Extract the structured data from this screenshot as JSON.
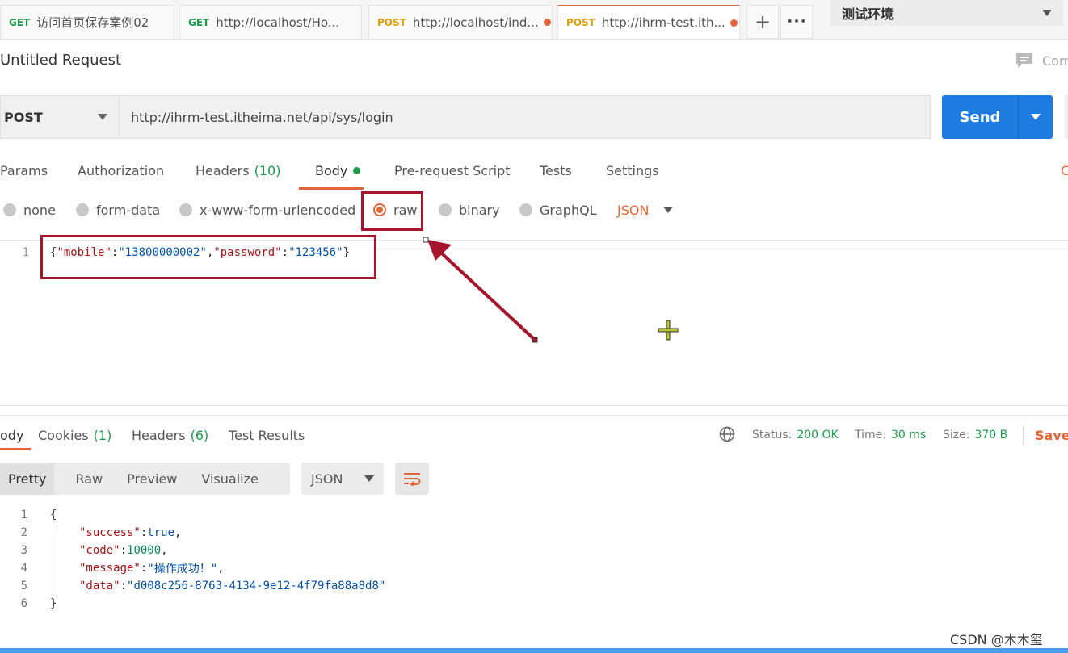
{
  "tabs": [
    {
      "method": "GET",
      "title": "访问首页保存案例02",
      "modified": false,
      "active": false
    },
    {
      "method": "GET",
      "title": "http://localhost/Ho...",
      "modified": false,
      "active": false
    },
    {
      "method": "POST",
      "title": "http://localhost/ind...",
      "modified": true,
      "active": false
    },
    {
      "method": "POST",
      "title": "http://ihrm-test.ith...",
      "modified": true,
      "active": true
    }
  ],
  "tab_actions": {
    "add": "+",
    "more": "•••"
  },
  "environment": {
    "selected": "测试环境"
  },
  "request": {
    "title": "Untitled Request",
    "comments_label": "Com",
    "method": "POST",
    "url": "http://ihrm-test.itheima.net/api/sys/login",
    "send_label": "Send",
    "sub_tabs": {
      "params": "Params",
      "authorization": "Authorization",
      "headers": "Headers",
      "headers_count": "(10)",
      "body": "Body",
      "prerequest": "Pre-request Script",
      "tests": "Tests",
      "settings": "Settings",
      "cookies_partial": "C"
    },
    "body_modes": {
      "none": "none",
      "form_data": "form-data",
      "urlencoded": "x-www-form-urlencoded",
      "raw": "raw",
      "binary": "binary",
      "graphql": "GraphQL",
      "selected": "raw"
    },
    "raw_type": "JSON",
    "body_code": {
      "line_no": "1",
      "k1": "\"mobile\"",
      "v1": "\"13800000002\"",
      "k2": "\"password\"",
      "v2": "\"123456\""
    }
  },
  "response": {
    "tabs": {
      "body": "ody",
      "cookies": "Cookies",
      "cookies_count": "(1)",
      "headers": "Headers",
      "headers_count": "(6)",
      "test_results": "Test Results"
    },
    "status_label": "Status:",
    "status_value": "200 OK",
    "time_label": "Time:",
    "time_value": "30 ms",
    "size_label": "Size:",
    "size_value": "370 B",
    "save_label": "Save",
    "formats": {
      "pretty": "Pretty",
      "raw": "Raw",
      "preview": "Preview",
      "visualize": "Visualize"
    },
    "format_type": "JSON",
    "lines": {
      "n1": "1",
      "n2": "2",
      "n3": "3",
      "n4": "4",
      "n5": "5",
      "n6": "6",
      "open": "{",
      "k_success": "\"success\"",
      "v_success": "true",
      "k_code": "\"code\"",
      "v_code": "10000",
      "k_message": "\"message\"",
      "v_message": "\"操作成功！\"",
      "k_data": "\"data\"",
      "v_data": "\"d008c256-8763-4134-9e12-4f79fa88a8d8\"",
      "close": "}"
    }
  },
  "watermark": "CSDN @木木玺",
  "colors": {
    "accent": "#e3663a",
    "send": "#1e7ce0",
    "success": "#1d9a4b",
    "annotation": "#a5162c"
  }
}
